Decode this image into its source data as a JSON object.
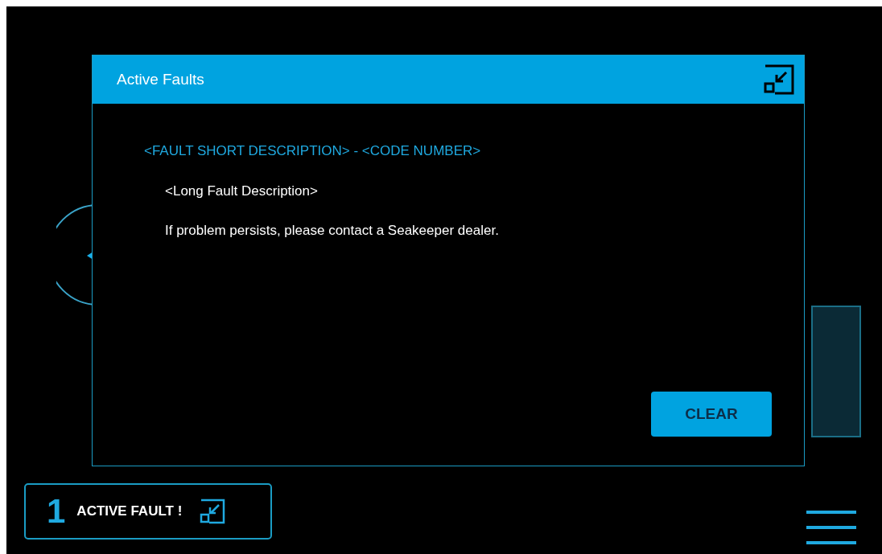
{
  "dialog": {
    "title": "Active Faults",
    "fault_heading": "<FAULT SHORT DESCRIPTION> - <CODE NUMBER>",
    "description": "<Long Fault Description>",
    "message": "If problem persists, please contact a Seakeeper dealer.",
    "clear_button": "CLEAR"
  },
  "fault_badge": {
    "count": "1",
    "label": "ACTIVE FAULT !"
  }
}
